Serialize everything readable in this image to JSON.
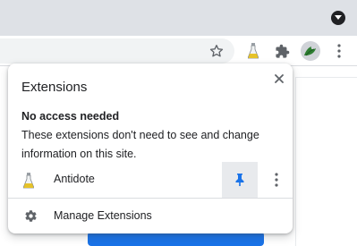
{
  "browser": {
    "icons": {
      "tab_menu": "chevron-down-icon",
      "bookmark": "star-icon",
      "extension": "flask-icon",
      "extensions_menu": "puzzle-icon",
      "profile": "avatar-icon",
      "more": "vertical-dots-icon"
    }
  },
  "popup": {
    "title": "Extensions",
    "close_icon": "close-icon",
    "section": {
      "heading": "No access needed",
      "description": "These extensions don't need to see and change information on this site."
    },
    "extensions": [
      {
        "name": "Antidote",
        "icon": "flask-icon",
        "pinned": true,
        "pin_icon": "pin-icon",
        "menu_icon": "vertical-dots-icon"
      }
    ],
    "manage": {
      "label": "Manage Extensions",
      "icon": "gear-icon"
    }
  },
  "colors": {
    "accent": "#1a73e8",
    "text": "#202124",
    "tabstrip": "#dee1e6"
  }
}
